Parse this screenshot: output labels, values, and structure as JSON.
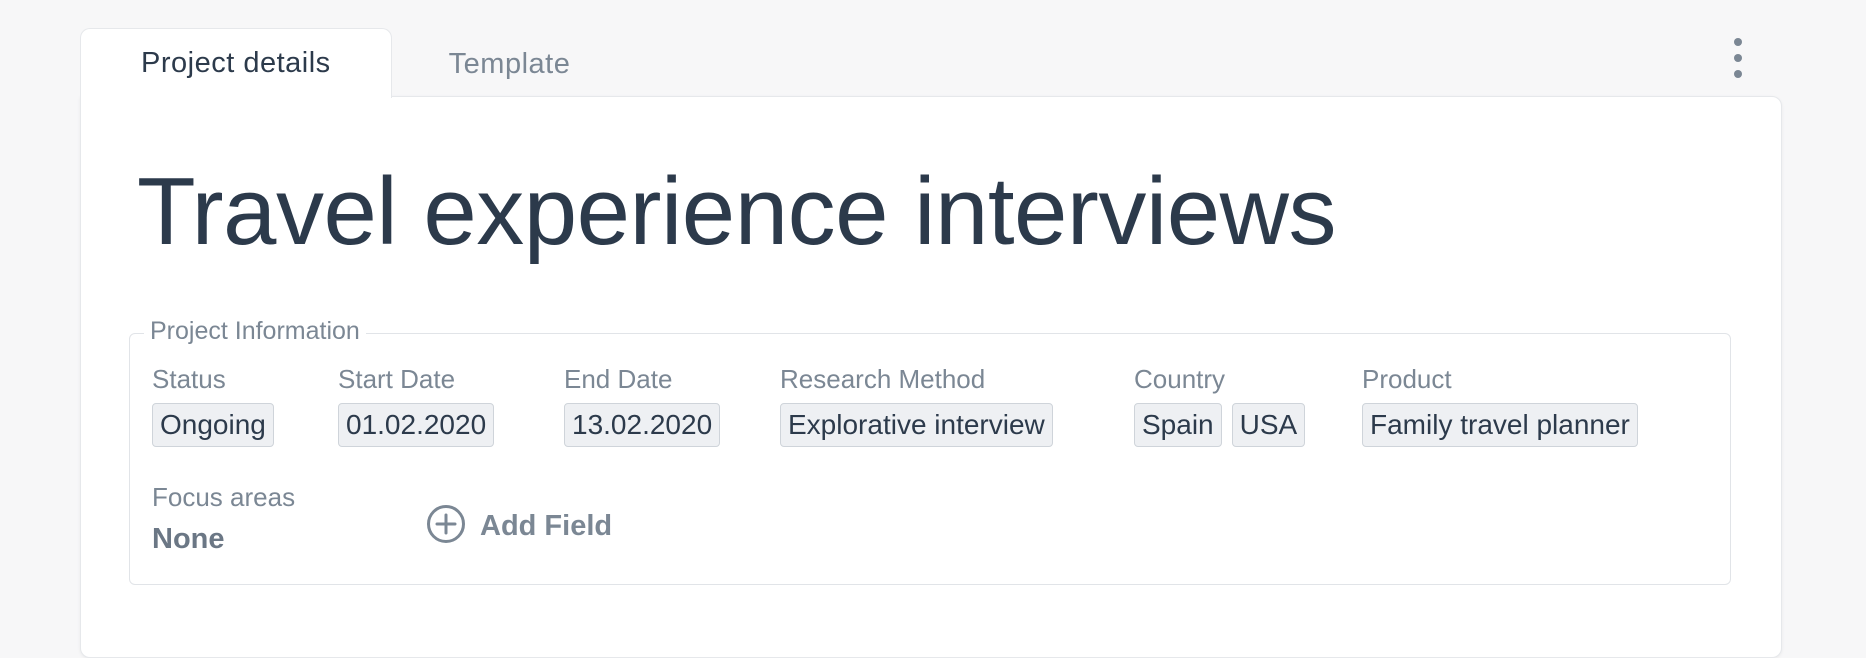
{
  "tabs": {
    "project_details": "Project details",
    "template": "Template"
  },
  "project": {
    "title": "Travel experience interviews"
  },
  "info": {
    "legend": "Project Information",
    "fields": [
      {
        "label": "Status",
        "values": [
          "Ongoing"
        ]
      },
      {
        "label": "Start Date",
        "values": [
          "01.02.2020"
        ]
      },
      {
        "label": "End Date",
        "values": [
          "13.02.2020"
        ]
      },
      {
        "label": "Research Method",
        "values": [
          "Explorative interview"
        ]
      },
      {
        "label": "Country",
        "values": [
          "Spain",
          "USA"
        ]
      },
      {
        "label": "Product",
        "values": [
          "Family travel planner"
        ]
      }
    ],
    "focus_areas": {
      "label": "Focus areas",
      "value": "None"
    },
    "add_field_label": "Add Field"
  },
  "icons": {
    "menu": "kebab-menu-icon",
    "add": "plus-circle-icon"
  },
  "colors": {
    "text": "#2c3a4b",
    "muted": "#7b8794",
    "chip_bg": "#eef0f3",
    "chip_border": "#cfd4da"
  }
}
